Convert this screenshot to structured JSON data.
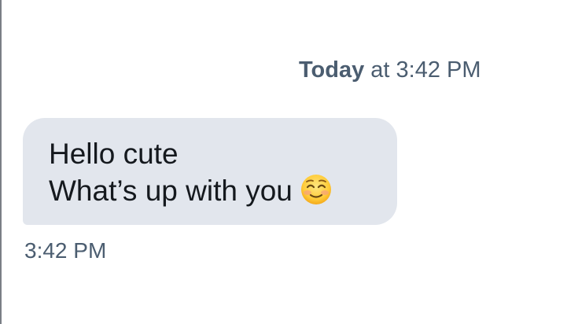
{
  "header": {
    "day": "Today",
    "rest": " at 3:42 PM"
  },
  "message": {
    "line1": "Hello cute",
    "line2": "What’s up with you",
    "emoji": "smiling-face-with-smiling-eyes",
    "timestamp": "3:42 PM"
  },
  "colors": {
    "bubble": "#e2e6ed",
    "meta_text": "#4b5d70",
    "message_text": "#15191e"
  }
}
